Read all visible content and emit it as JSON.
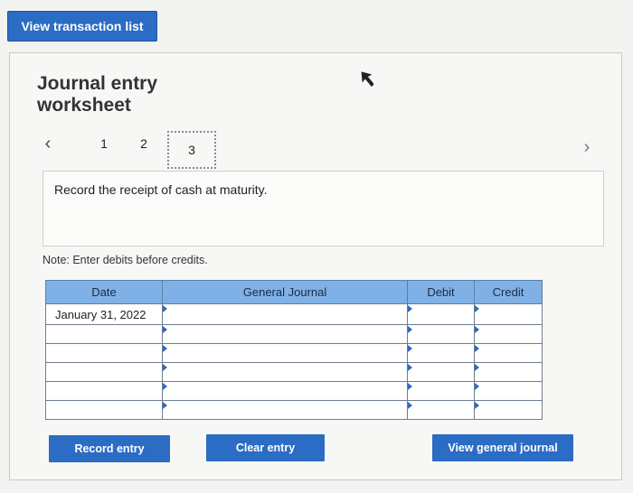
{
  "header": {
    "view_transactions_label": "View transaction list"
  },
  "worksheet": {
    "title": "Journal entry worksheet",
    "pager": {
      "pages": [
        "1",
        "2",
        "3"
      ],
      "current": "3"
    },
    "instruction": "Record the receipt of cash at maturity.",
    "note": "Note: Enter debits before credits."
  },
  "table": {
    "columns": [
      "Date",
      "General Journal",
      "Debit",
      "Credit"
    ],
    "rows": [
      {
        "date": "January 31, 2022",
        "account": "",
        "debit": "",
        "credit": ""
      },
      {
        "date": "",
        "account": "",
        "debit": "",
        "credit": ""
      },
      {
        "date": "",
        "account": "",
        "debit": "",
        "credit": ""
      },
      {
        "date": "",
        "account": "",
        "debit": "",
        "credit": ""
      },
      {
        "date": "",
        "account": "",
        "debit": "",
        "credit": ""
      },
      {
        "date": "",
        "account": "",
        "debit": "",
        "credit": ""
      }
    ]
  },
  "actions": {
    "record_label": "Record entry",
    "clear_label": "Clear entry",
    "view_general_label": "View general journal"
  },
  "colors": {
    "accent": "#2b6cc4",
    "header_bg": "#7fb1e6"
  }
}
